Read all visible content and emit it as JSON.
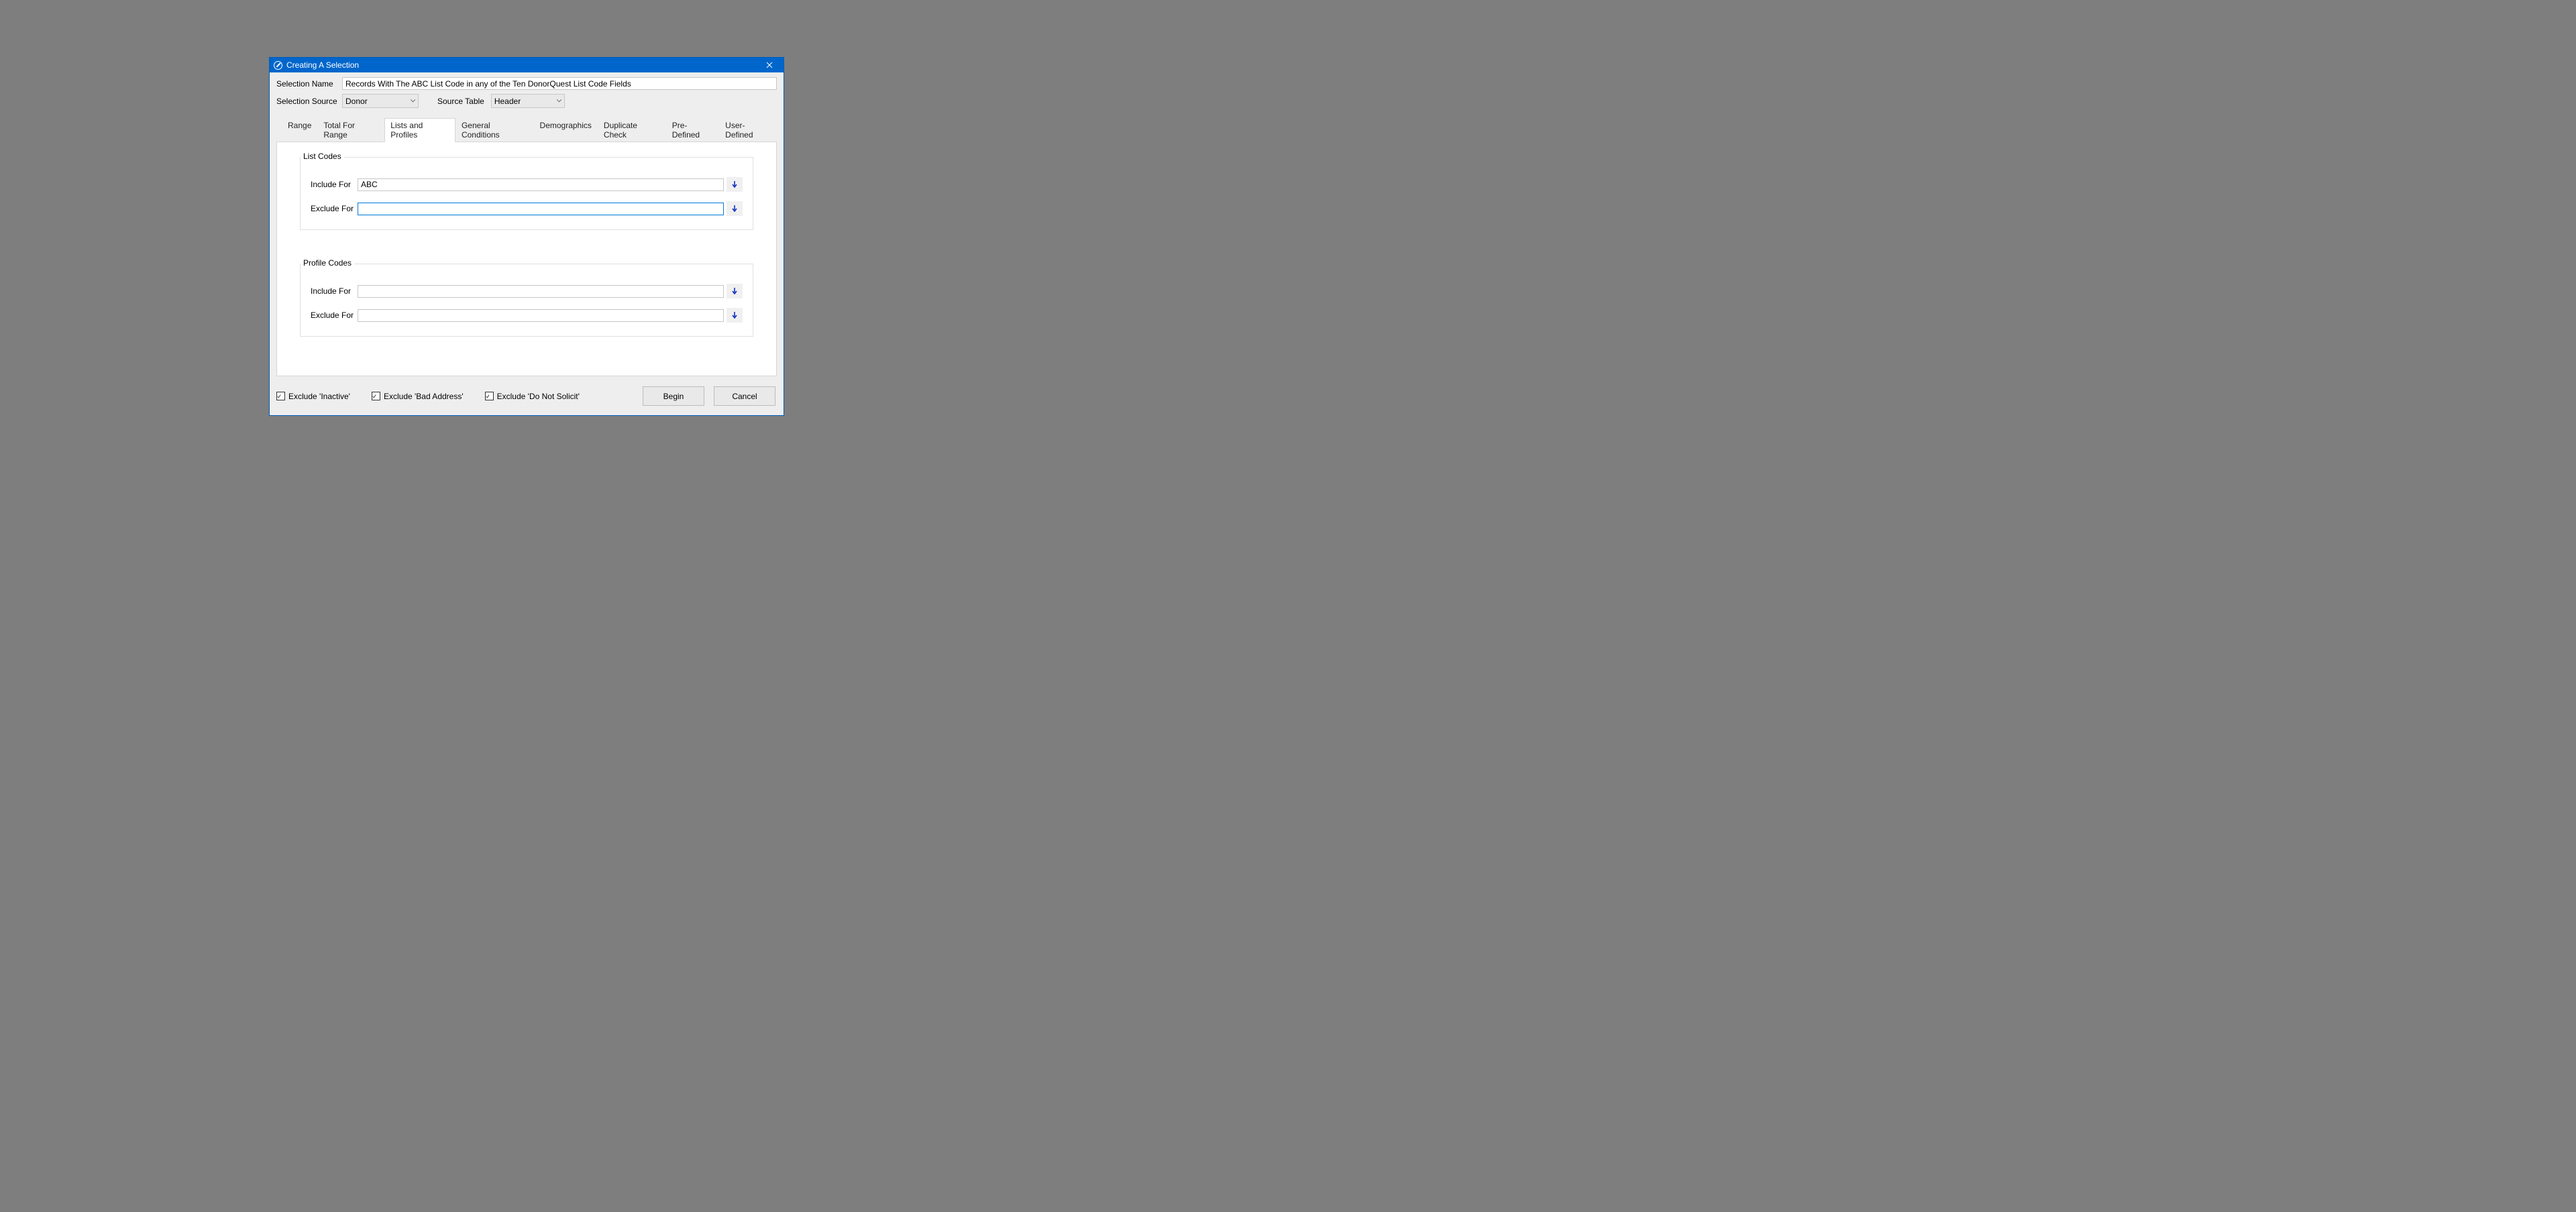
{
  "title": "Creating A Selection",
  "labels": {
    "selection_name": "Selection Name",
    "selection_source": "Selection Source",
    "source_table": "Source Table"
  },
  "selection_name_value": "Records With The ABC List Code in any of the Ten DonorQuest List Code Fields",
  "selection_source_value": "Donor",
  "source_table_value": "Header",
  "tabs": [
    "Range",
    "Total For Range",
    "Lists and Profiles",
    "General Conditions",
    "Demographics",
    "Duplicate Check",
    "Pre-Defined",
    "User-Defined"
  ],
  "active_tab_index": 2,
  "groups": {
    "list_codes": {
      "legend": "List Codes",
      "include_label": "Include For",
      "include_value": "ABC",
      "exclude_label": "Exclude For",
      "exclude_value": ""
    },
    "profile_codes": {
      "legend": "Profile Codes",
      "include_label": "Include For",
      "include_value": "",
      "exclude_label": "Exclude For",
      "exclude_value": ""
    }
  },
  "checkboxes": {
    "exclude_inactive": {
      "label": "Exclude 'Inactive'",
      "checked": true
    },
    "exclude_bad_address": {
      "label": "Exclude 'Bad Address'",
      "checked": true
    },
    "exclude_do_not_solicit": {
      "label": "Exclude 'Do Not Solicit'",
      "checked": true
    }
  },
  "buttons": {
    "begin": "Begin",
    "cancel": "Cancel"
  }
}
